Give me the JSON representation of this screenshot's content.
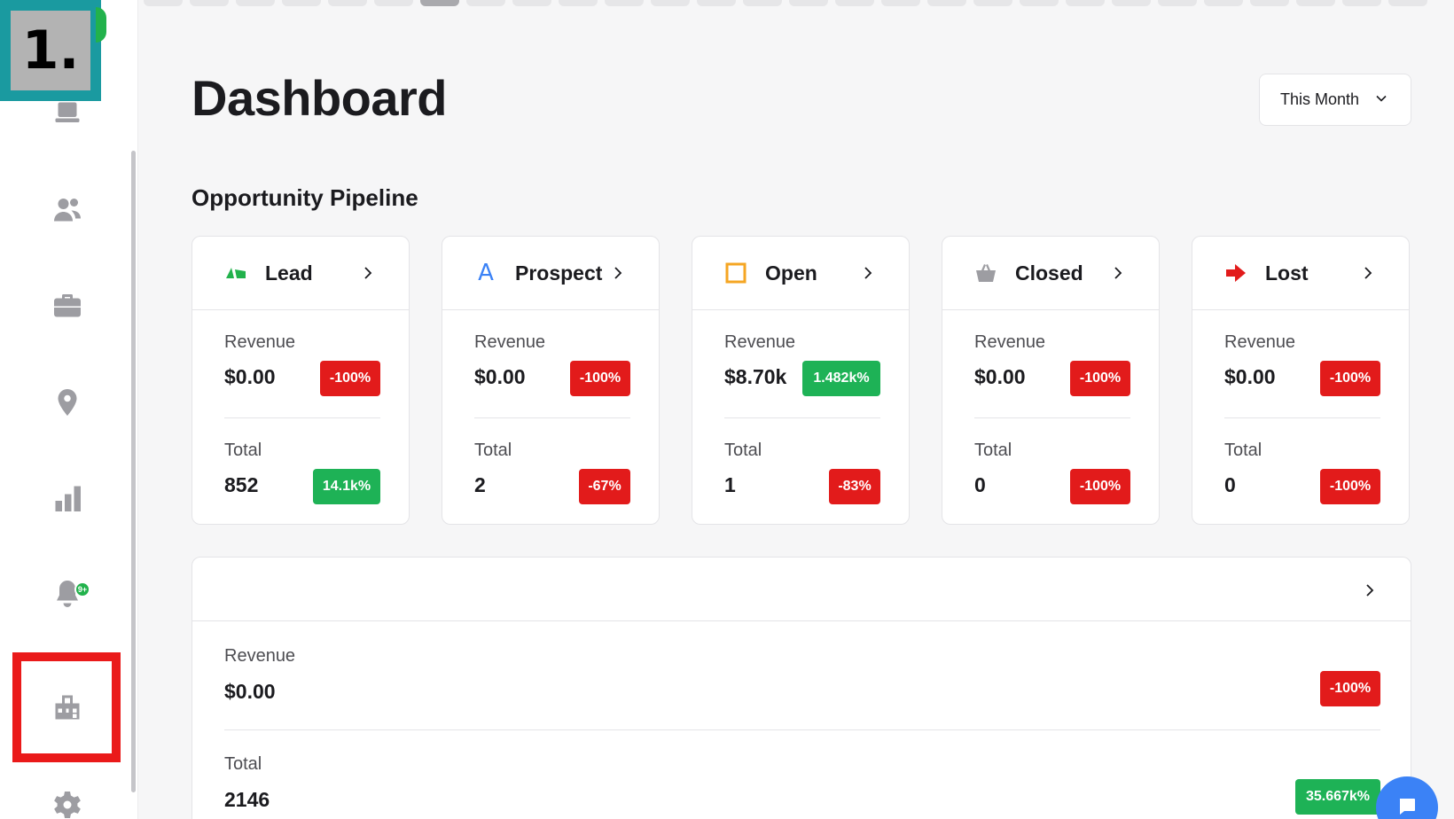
{
  "step_marker": "1.",
  "header": {
    "title": "Dashboard",
    "period": "This Month"
  },
  "notifications": {
    "badge": "9+"
  },
  "pipeline": {
    "title": "Opportunity Pipeline",
    "stages": [
      {
        "name": "Lead",
        "icon": "lead-icon",
        "icon_color": "#22b24c",
        "revenue": "$0.00",
        "revenue_change": "-100%",
        "revenue_trend": "down",
        "total": "852",
        "total_change": "14.1k%",
        "total_trend": "up"
      },
      {
        "name": "Prospect",
        "icon": "prospect-a-icon",
        "icon_color": "#3b82f6",
        "revenue": "$0.00",
        "revenue_change": "-100%",
        "revenue_trend": "down",
        "total": "2",
        "total_change": "-67%",
        "total_trend": "down"
      },
      {
        "name": "Open",
        "icon": "open-square-icon",
        "icon_color": "#f5a623",
        "revenue": "$8.70k",
        "revenue_change": "1.482k%",
        "revenue_trend": "up",
        "total": "1",
        "total_change": "-83%",
        "total_trend": "down"
      },
      {
        "name": "Closed",
        "icon": "basket-icon",
        "icon_color": "#9d9da2",
        "revenue": "$0.00",
        "revenue_change": "-100%",
        "revenue_trend": "down",
        "total": "0",
        "total_change": "-100%",
        "total_trend": "down"
      },
      {
        "name": "Lost",
        "icon": "lost-arrow-icon",
        "icon_color": "#e21b1b",
        "revenue": "$0.00",
        "revenue_change": "-100%",
        "revenue_trend": "down",
        "total": "0",
        "total_change": "-100%",
        "total_trend": "down"
      }
    ],
    "metric_labels": {
      "revenue": "Revenue",
      "total": "Total"
    }
  },
  "summary": {
    "revenue_label": "Revenue",
    "revenue": "$0.00",
    "revenue_change": "-100%",
    "total_label": "Total",
    "total": "2146",
    "total_change": "35.667k%"
  },
  "colors": {
    "negative": "#e21b1b",
    "positive": "#1eb256",
    "highlight": "#ea1a1a",
    "step_marker": "#1a9aa0",
    "chat": "#3b82f6"
  }
}
